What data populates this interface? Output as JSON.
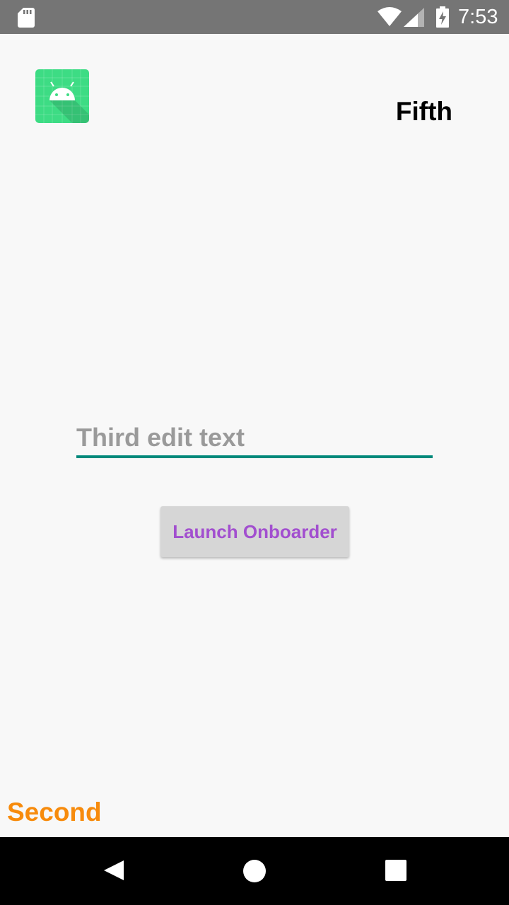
{
  "status_bar": {
    "time": "7:53",
    "icons": [
      "sd-card-icon",
      "wifi-icon",
      "signal-icon",
      "battery-charging-icon"
    ]
  },
  "app": {
    "icon": "android-app-icon",
    "fifth_label": "Fifth",
    "edit_text": {
      "value": "",
      "placeholder": "Third edit text"
    },
    "launch_button_label": "Launch Onboarder",
    "second_label": "Second"
  },
  "nav_bar": {
    "icons": [
      "back-icon",
      "home-icon",
      "recents-icon"
    ]
  },
  "colors": {
    "status_bar": "#757575",
    "edit_underline": "#00897b",
    "button_text": "#a24fcf",
    "second_label": "#f78b0c",
    "app_icon_bg": "#3ddc84"
  }
}
